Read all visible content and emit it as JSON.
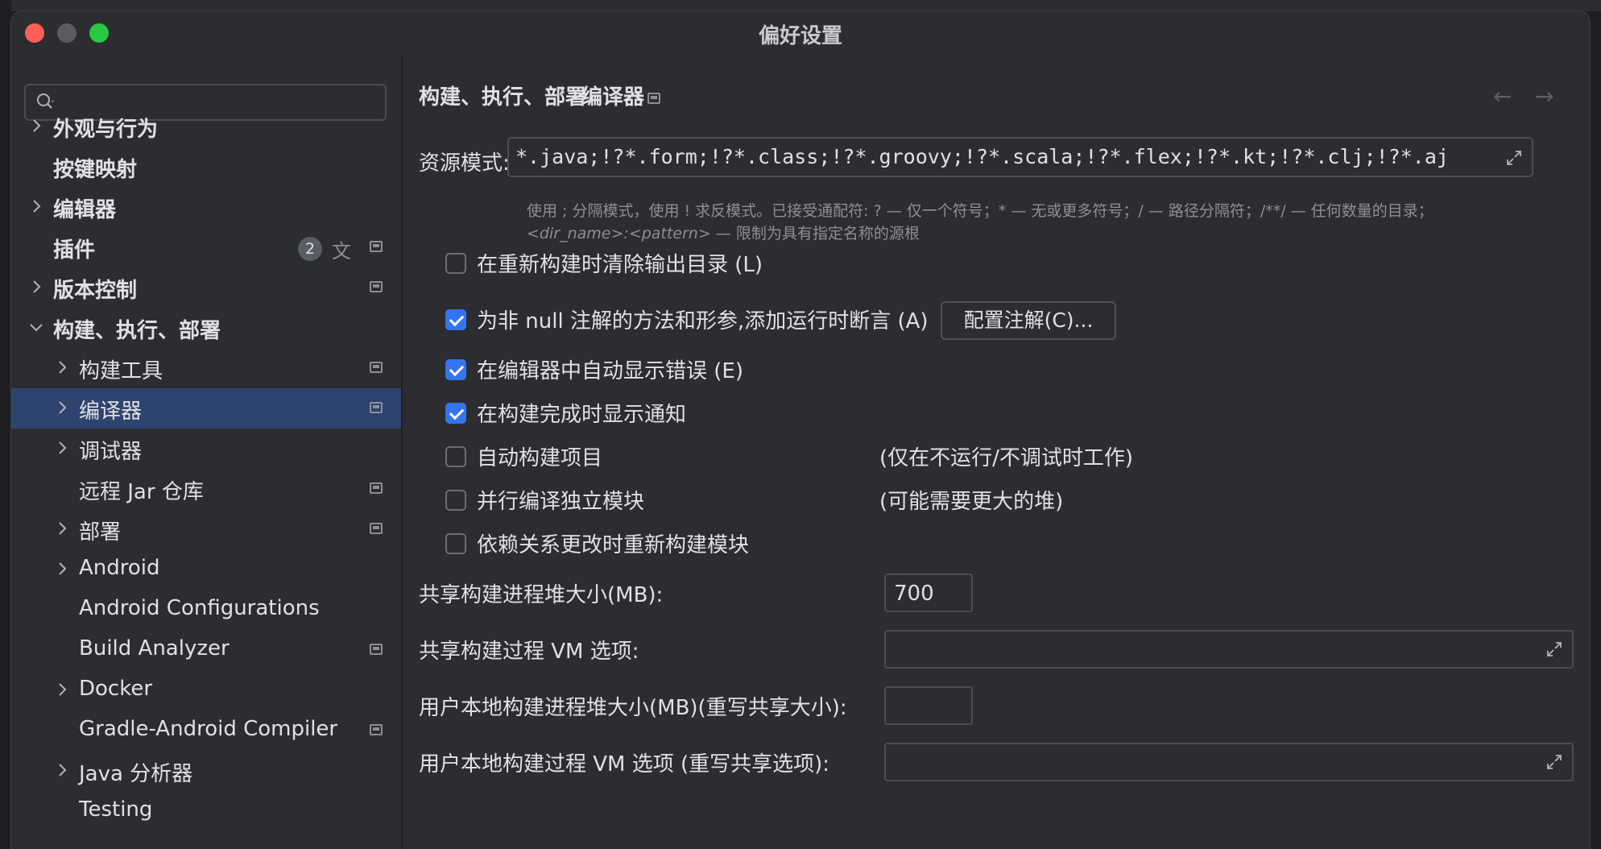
{
  "window": {
    "title": "偏好设置"
  },
  "search": {
    "placeholder": ""
  },
  "sidebar": {
    "items": [
      {
        "label": "外观与行为"
      },
      {
        "label": "按键映射"
      },
      {
        "label": "编辑器"
      },
      {
        "label": "插件",
        "badge": "2"
      },
      {
        "label": "版本控制"
      },
      {
        "label": "构建、执行、部署"
      },
      {
        "label": "构建工具"
      },
      {
        "label": "编译器"
      },
      {
        "label": "调试器"
      },
      {
        "label": "远程 Jar 仓库"
      },
      {
        "label": "部署"
      },
      {
        "label": "Android"
      },
      {
        "label": "Android Configurations"
      },
      {
        "label": "Build Analyzer"
      },
      {
        "label": "Docker"
      },
      {
        "label": "Gradle-Android Compiler"
      },
      {
        "label": "Java 分析器"
      },
      {
        "label": "Testing"
      }
    ]
  },
  "breadcrumb": {
    "parent": "构建、执行、部署",
    "current": "编译器",
    "separator": "›"
  },
  "nav": {
    "back": "←",
    "forward": "→"
  },
  "resource": {
    "label": "资源模式:",
    "value": "*.java;!?*.form;!?*.class;!?*.groovy;!?*.scala;!?*.flex;!?*.kt;!?*.clj;!?*.aj",
    "help_part1": "使用 ; 分隔模式，使用 ! 求反模式。已接受通配符: ? — 仅一个符号；* — 无或更多符号；/ — 路径分隔符；/**/ — 任何数量的目录；",
    "help_italic": "<dir_name>:<pattern>",
    "help_part2": " — 限制为具有指定名称的源根"
  },
  "options": {
    "clear_output": "在重新构建时清除输出目录 (L)",
    "not_null": "为非 null 注解的方法和形参,添加运行时断言 (A)",
    "config_button": "配置注解(C)...",
    "auto_show_errors": "在编辑器中自动显示错误 (E)",
    "notify_build": "在构建完成时显示通知",
    "auto_build": "自动构建项目",
    "auto_build_note": "(仅在不运行/不调试时工作)",
    "parallel": "并行编译独立模块",
    "parallel_note": "(可能需要更大的堆)",
    "rebuild_deps": "依赖关系更改时重新构建模块"
  },
  "heap": {
    "shared_label": "共享构建进程堆大小(MB):",
    "shared_value": "700",
    "shared_vm_label": "共享构建过程 VM 选项:",
    "user_label": "用户本地构建进程堆大小(MB)(重写共享大小):",
    "user_value": "",
    "user_vm_label": "用户本地构建过程 VM 选项 (重写共享选项):"
  },
  "colors": {
    "accent": "#3574f0",
    "selection": "#2e436e",
    "background": "#2b2d30"
  }
}
